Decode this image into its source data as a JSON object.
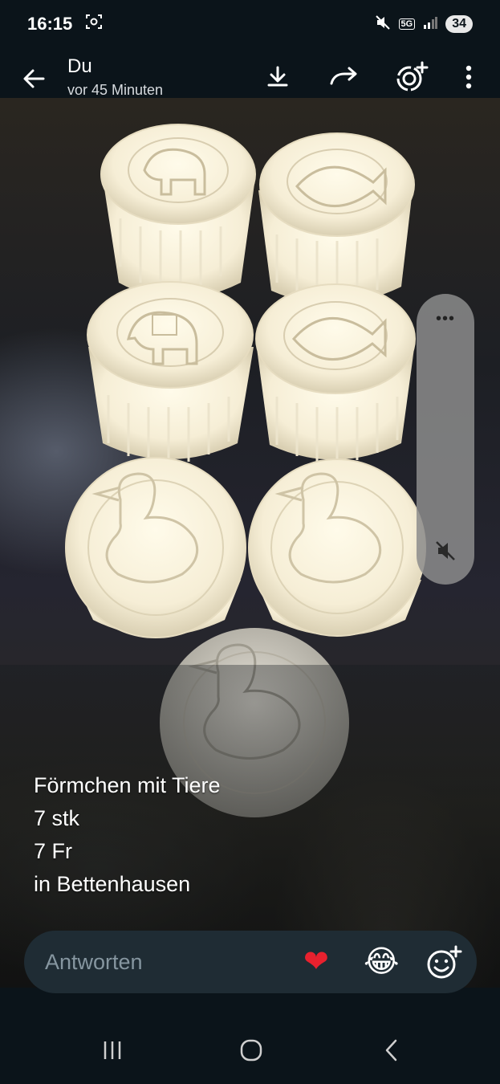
{
  "status_bar": {
    "time": "16:15",
    "network": "5G",
    "battery": "34"
  },
  "header": {
    "title": "Du",
    "subtitle": "vor 45 Minuten",
    "icons": [
      "back-arrow-icon",
      "download-icon",
      "forward-icon",
      "status-camera-icon",
      "more-vert-icon"
    ]
  },
  "status_post": {
    "caption_lines": [
      "Förmchen mit Tiere",
      "7 stk",
      "7 Fr",
      "in Bettenhausen"
    ],
    "molds": [
      "elephant",
      "fish",
      "elephant",
      "fish",
      "duck",
      "duck",
      "duck"
    ]
  },
  "volume_panel": {
    "menu_label": "•••",
    "muted": true
  },
  "reply": {
    "placeholder": "Antworten",
    "reaction_1": "❤",
    "reaction_2": "😂"
  },
  "nav": {
    "icons": [
      "recent-apps-icon",
      "home-icon",
      "back-icon"
    ]
  },
  "colors": {
    "background": "#0b141a",
    "reply_bar": "#1f2c34",
    "placeholder": "#8696a0",
    "heart": "#e8212e"
  }
}
